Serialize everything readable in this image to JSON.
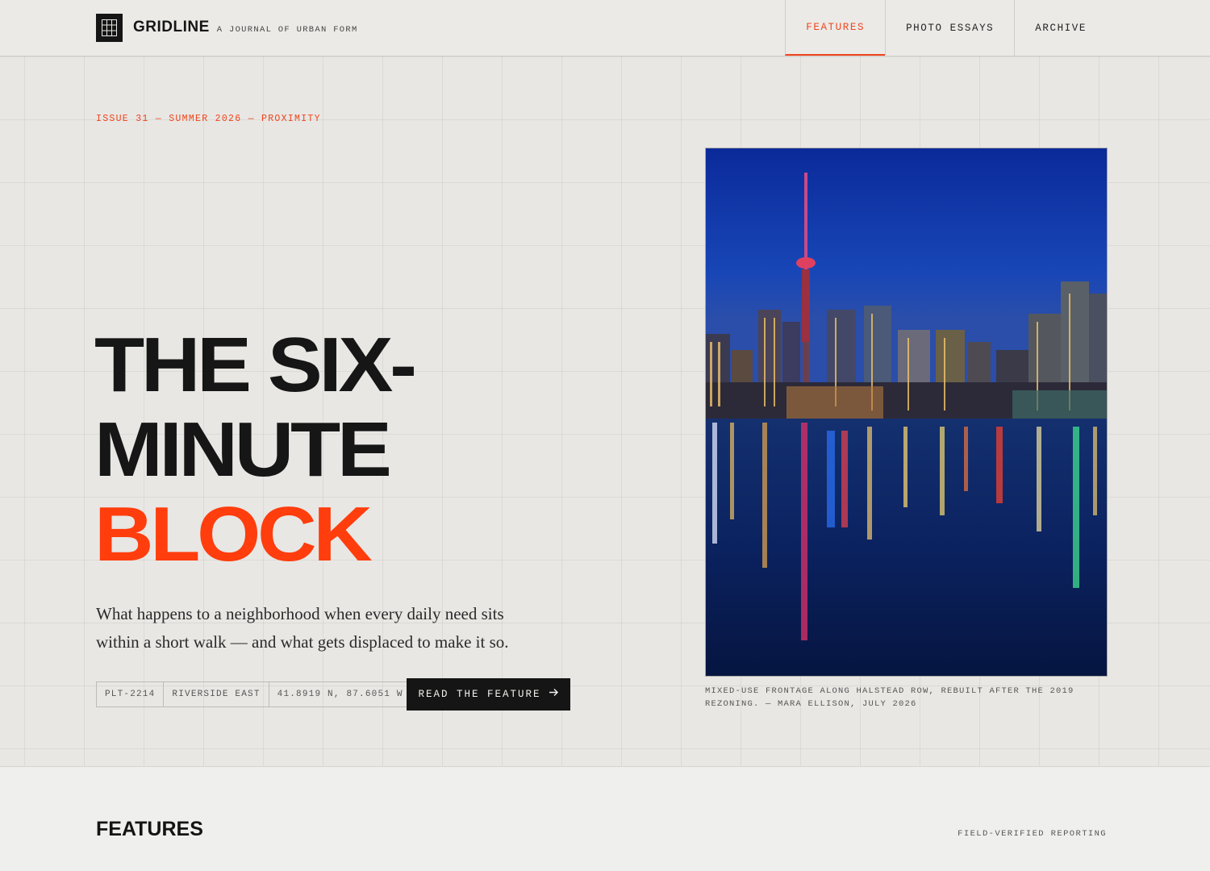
{
  "header": {
    "brand_name": "GRIDLINE",
    "brand_tagline": "A JOURNAL OF URBAN FORM",
    "logo_icon": "grid-icon",
    "nav": [
      {
        "label": "FEATURES",
        "active": true
      },
      {
        "label": "PHOTO ESSAYS",
        "active": false
      },
      {
        "label": "ARCHIVE",
        "active": false
      }
    ]
  },
  "hero": {
    "kicker": "ISSUE 31 — SUMMER 2026 — PROXIMITY",
    "headline_line1": "THE SIX-",
    "headline_line2": "MINUTE",
    "headline_accent": "BLOCK",
    "dek": "What happens to a neighborhood when every daily need sits within a short walk — and what gets displaced to make it so.",
    "chips": [
      "PLT-2214",
      "RIVERSIDE EAST",
      "41.8919 N, 87.6051 W"
    ],
    "cta_label": "READ THE FEATURE",
    "cta_icon": "arrow-right-icon"
  },
  "photo": {
    "caption": "MIXED-USE FRONTAGE ALONG HALSTEAD ROW, REBUILT AFTER THE 2019 REZONING. — MARA ELLISON, JULY 2026"
  },
  "features": {
    "title": "FEATURES",
    "right_label": "FIELD-VERIFIED REPORTING"
  },
  "colors": {
    "accent": "#ff3d0d",
    "ink": "#151515",
    "background": "#e8e7e4"
  }
}
